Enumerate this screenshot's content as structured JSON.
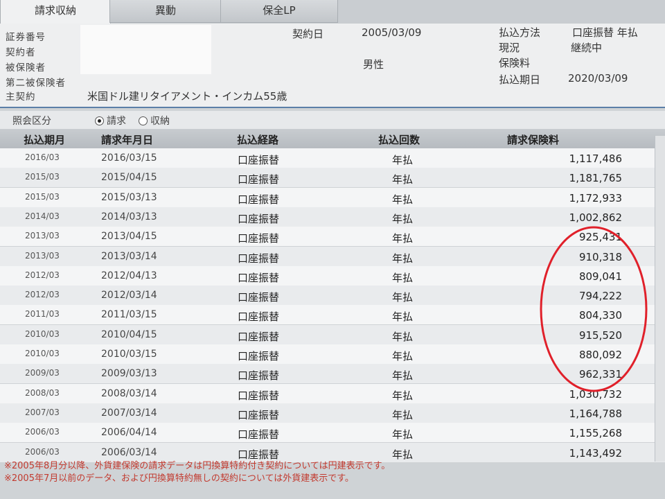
{
  "tabs": [
    "請求収納",
    "異動",
    "保全LP"
  ],
  "info": {
    "labels": [
      "証券番号",
      "契約者",
      "被保険者",
      "第二被保険者",
      "主契約"
    ],
    "contract_date_label": "契約日",
    "contract_date": "2005/03/09",
    "gender": "男性",
    "main_contract": "米国ドル建リタイアメント・インカム55歳",
    "payment_method_label": "払込方法",
    "payment_method": "口座振替 年払",
    "status_label": "現況",
    "status": "継続中",
    "premium_label": "保険料",
    "due_date_label": "払込期日",
    "due_date": "2020/03/09"
  },
  "filter": {
    "label": "照会区分",
    "options": [
      "請求",
      "収納"
    ],
    "selected": "請求"
  },
  "table": {
    "headers": [
      "払込期月",
      "請求年月日",
      "払込経路",
      "払込回数",
      "請求保険料"
    ],
    "rows": [
      [
        "2016/03",
        "2016/03/15",
        "口座振替",
        "年払",
        "1,117,486"
      ],
      [
        "2015/03",
        "2015/04/15",
        "口座振替",
        "年払",
        "1,181,765"
      ],
      [
        "2015/03",
        "2015/03/13",
        "口座振替",
        "年払",
        "1,172,933"
      ],
      [
        "2014/03",
        "2014/03/13",
        "口座振替",
        "年払",
        "1,002,862"
      ],
      [
        "2013/03",
        "2013/04/15",
        "口座振替",
        "年払",
        "925,431"
      ],
      [
        "2013/03",
        "2013/03/14",
        "口座振替",
        "年払",
        "910,318"
      ],
      [
        "2012/03",
        "2012/04/13",
        "口座振替",
        "年払",
        "809,041"
      ],
      [
        "2012/03",
        "2012/03/14",
        "口座振替",
        "年払",
        "794,222"
      ],
      [
        "2011/03",
        "2011/03/15",
        "口座振替",
        "年払",
        "804,330"
      ],
      [
        "2010/03",
        "2010/04/15",
        "口座振替",
        "年払",
        "915,520"
      ],
      [
        "2010/03",
        "2010/03/15",
        "口座振替",
        "年払",
        "880,092"
      ],
      [
        "2009/03",
        "2009/03/13",
        "口座振替",
        "年払",
        "962,331"
      ],
      [
        "2008/03",
        "2008/03/14",
        "口座振替",
        "年払",
        "1,030,732"
      ],
      [
        "2007/03",
        "2007/03/14",
        "口座振替",
        "年払",
        "1,164,788"
      ],
      [
        "2006/03",
        "2006/04/14",
        "口座振替",
        "年払",
        "1,155,268"
      ],
      [
        "2006/03",
        "2006/03/14",
        "口座振替",
        "年払",
        "1,143,492"
      ]
    ]
  },
  "notes": [
    "※2005年8月分以降、外貨建保険の請求データは円換算特約付き契約については円建表示です。",
    "※2005年7月以前のデータ、および円換算特約無しの契約については外貨建表示です。"
  ],
  "colors": {
    "highlight_circle": "#e0202a",
    "header_rule": "#5b7fa8",
    "note_text": "#c23a2f"
  }
}
